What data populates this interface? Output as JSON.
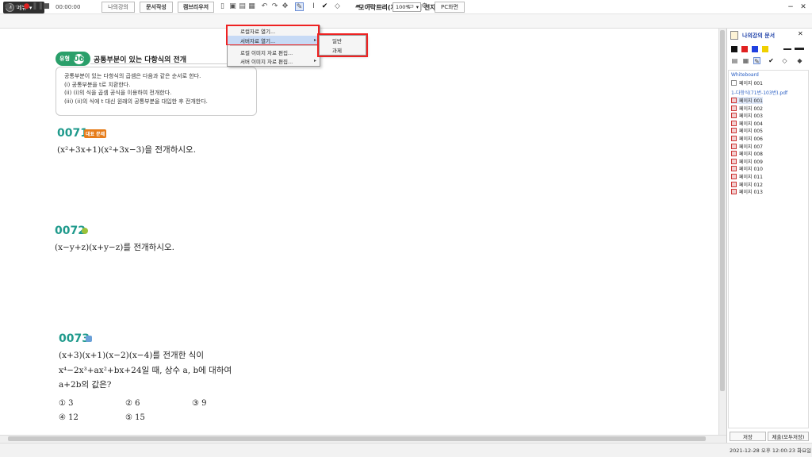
{
  "app": {
    "title": "모이락트리(저작도구 및 전자노트)",
    "menu_label": "메뉴",
    "logo_text": "M"
  },
  "toolbar": {
    "time": "00:00:00",
    "my_lecture": "나의강의",
    "doc_write": "문서작성",
    "campus_bridge": "캠브리우저",
    "zoom": "100%",
    "pc_screen": "PC화면"
  },
  "context_menu": {
    "items": [
      "로컬자료 열기...",
      "서버자료 열기...",
      "로컬 이미지 자료 편집...",
      "서버 이미지 자료 편집..."
    ],
    "submenu": [
      "일반",
      "과제"
    ]
  },
  "document": {
    "unit_label": "유형",
    "unit_number": "06",
    "unit_title": "공통부분이 있는 다항식의 전개",
    "box_lines": [
      "공통부분이 있는 다항식의 곱셈은 다음과 같은 순서로 한다.",
      "(i) 공통부분을 t로 치환한다.",
      "(ii) (i)의 식을 곱셈 공식을 이용하여 전개한다.",
      "(iii) (ii)의 식에 t 대신 원래의 공통부분을 대입한 후 전개한다."
    ],
    "problems": [
      {
        "number": "0071",
        "tag": "대표 문제",
        "text": "(x²+3x+1)(x²+3x−3)을 전개하시오."
      },
      {
        "number": "0072",
        "text": "(x−y+z)(x+y−z)를 전개하시오."
      },
      {
        "number": "0073",
        "lines": [
          "(x+3)(x+1)(x−2)(x−4)를 전개한 식이",
          "x⁴−2x³+ax²+bx+24일 때, 상수 a, b에 대하여",
          "a+2b의 값은?"
        ],
        "choices": [
          "① 3",
          "② 6",
          "③ 9",
          "④ 12",
          "⑤ 15"
        ]
      }
    ]
  },
  "right_panel": {
    "title": "나의강의 문서",
    "group_whiteboard": "Whiteboard",
    "whiteboard_pages": [
      "페이지 001"
    ],
    "group_pdf": "1-다항식(71번-103번).pdf",
    "pdf_pages": [
      "페이지 001",
      "페이지 002",
      "페이지 003",
      "페이지 004",
      "페이지 005",
      "페이지 006",
      "페이지 007",
      "페이지 008",
      "페이지 009",
      "페이지 010",
      "페이지 011",
      "페이지 012",
      "페이지 013"
    ],
    "save": "저장",
    "submit": "제출(모두저장)",
    "colors": [
      "#111111",
      "#e02020",
      "#2040e0",
      "#f0d000"
    ]
  },
  "status": {
    "datetime": "2021-12-28 오후 12:00:23 화요일"
  }
}
